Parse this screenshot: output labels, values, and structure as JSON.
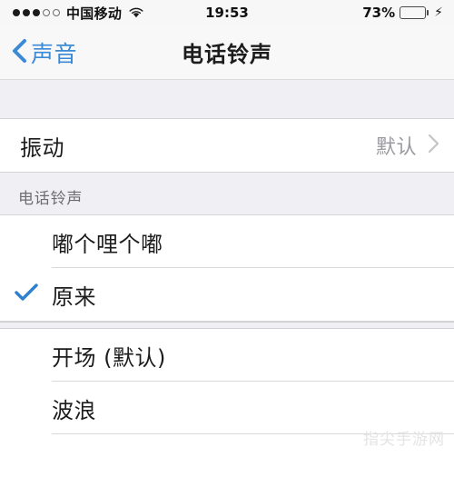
{
  "status_bar": {
    "signal_dots_filled": 3,
    "signal_dots_total": 5,
    "carrier": "中国移动",
    "wifi_icon": "wifi-icon",
    "time": "19:53",
    "battery_percent_label": "73%",
    "battery_level": 73,
    "charging_icon": "⚡",
    "battery_fill_color": "#4cd964"
  },
  "nav_bar": {
    "back_icon": "chevron-left-icon",
    "back_label": "声音",
    "title": "电话铃声",
    "accent_color": "#3a8ad6"
  },
  "vibration_section": {
    "rows": [
      {
        "label": "振动",
        "value": "默认",
        "disclosure_icon": "chevron-right-icon"
      }
    ]
  },
  "ringtone_section": {
    "header": "电话铃声",
    "selected_icon": "checkmark-icon",
    "selected_color": "#2f7fd0",
    "items": [
      {
        "label": "嘟个哩个嘟",
        "selected": false
      },
      {
        "label": "原来",
        "selected": true
      },
      {
        "label": "开场 (默认)",
        "selected": false
      },
      {
        "label": "波浪",
        "selected": false
      }
    ]
  },
  "watermark": {
    "text": "指尖手游网"
  }
}
